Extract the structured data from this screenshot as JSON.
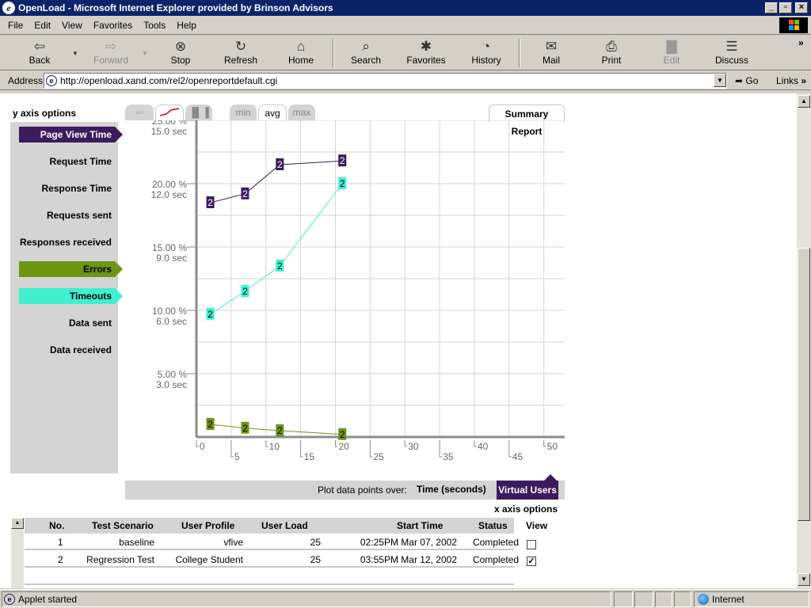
{
  "window": {
    "title": "OpenLoad - Microsoft Internet Explorer provided by Brinson Advisors",
    "app_icon": "ie-icon"
  },
  "menu": [
    "File",
    "Edit",
    "View",
    "Favorites",
    "Tools",
    "Help"
  ],
  "toolbar": {
    "back": "Back",
    "forward": "Forward",
    "stop": "Stop",
    "refresh": "Refresh",
    "home": "Home",
    "search": "Search",
    "favorites": "Favorites",
    "history": "History",
    "mail": "Mail",
    "print": "Print",
    "edit": "Edit",
    "discuss": "Discuss",
    "more": "»"
  },
  "address": {
    "label": "Address",
    "url": "http://openload.xand.com/rel2/openreportdefault.cgi",
    "go": "Go",
    "links": "Links"
  },
  "y_axis_options": {
    "title": "y axis options",
    "items": [
      {
        "label": "Page View Time",
        "selected": true,
        "color": "#3d1a5e"
      },
      {
        "label": "Request Time",
        "selected": false
      },
      {
        "label": "Response Time",
        "selected": false
      },
      {
        "label": "Requests sent",
        "selected": false
      },
      {
        "label": "Responses received",
        "selected": false
      },
      {
        "label": "Errors",
        "selected": true,
        "color": "#6e9414"
      },
      {
        "label": "Timeouts",
        "selected": true,
        "color": "#40f0cf"
      },
      {
        "label": "Data sent",
        "selected": false
      },
      {
        "label": "Data received",
        "selected": false
      }
    ]
  },
  "chart_tabs": {
    "stat_tabs": [
      "min",
      "avg",
      "max"
    ],
    "active_stat": "avg",
    "active_chart_type": "line",
    "summary_report": "Summary Report"
  },
  "chart_data": {
    "type": "line",
    "title": "",
    "xlabel": "",
    "ylabel": "",
    "x_ticks": [
      "0",
      "5",
      "10",
      "15",
      "20",
      "25",
      "30",
      "35",
      "40",
      "45",
      "50"
    ],
    "y_ticks": [
      {
        "pct": "25.00 %",
        "sec": "15.0 sec"
      },
      {
        "pct": "20.00 %",
        "sec": "12.0 sec"
      },
      {
        "pct": "15.00 %",
        "sec": "9.0 sec"
      },
      {
        "pct": "10.00 %",
        "sec": "6.0 sec"
      },
      {
        "pct": "5.00 %",
        "sec": "3.0 sec"
      }
    ],
    "xlim": [
      0,
      53
    ],
    "ylim": [
      0,
      25
    ],
    "grid": true,
    "series": [
      {
        "name": "Page View Time",
        "color": "#3d1a5e",
        "point_label": "2",
        "points": [
          [
            2,
            18.5
          ],
          [
            7,
            19.2
          ],
          [
            12,
            21.5
          ],
          [
            21,
            21.8
          ]
        ]
      },
      {
        "name": "Timeouts",
        "color": "#40f0cf",
        "point_label": "2",
        "points": [
          [
            2,
            9.7
          ],
          [
            7,
            11.5
          ],
          [
            12,
            13.5
          ],
          [
            21,
            20.0
          ]
        ]
      },
      {
        "name": "Errors",
        "color": "#6e9414",
        "point_label": "2",
        "points": [
          [
            2,
            1.0
          ],
          [
            7,
            0.7
          ],
          [
            12,
            0.5
          ],
          [
            21,
            0.2
          ]
        ]
      }
    ]
  },
  "plot_over": {
    "label": "Plot data points over:",
    "time": "Time (seconds)",
    "virtual_users": "Virtual Users",
    "selected": "virtual_users"
  },
  "x_axis_options": "x axis options",
  "table": {
    "columns": [
      "No.",
      "Test Scenario",
      "User Profile",
      "User Load",
      "Start Time",
      "Status",
      "View"
    ],
    "rows": [
      {
        "no": "1",
        "scenario": "baseline",
        "profile": "vfive",
        "load": "25",
        "start": "02:25PM Mar 07, 2002",
        "status": "Completed",
        "view": false
      },
      {
        "no": "2",
        "scenario": "Regression Test",
        "profile": "College Student",
        "load": "25",
        "start": "03:55PM Mar 12, 2002",
        "status": "Completed",
        "view": true
      }
    ]
  },
  "status": {
    "text": "Applet started",
    "zone": "Internet"
  }
}
